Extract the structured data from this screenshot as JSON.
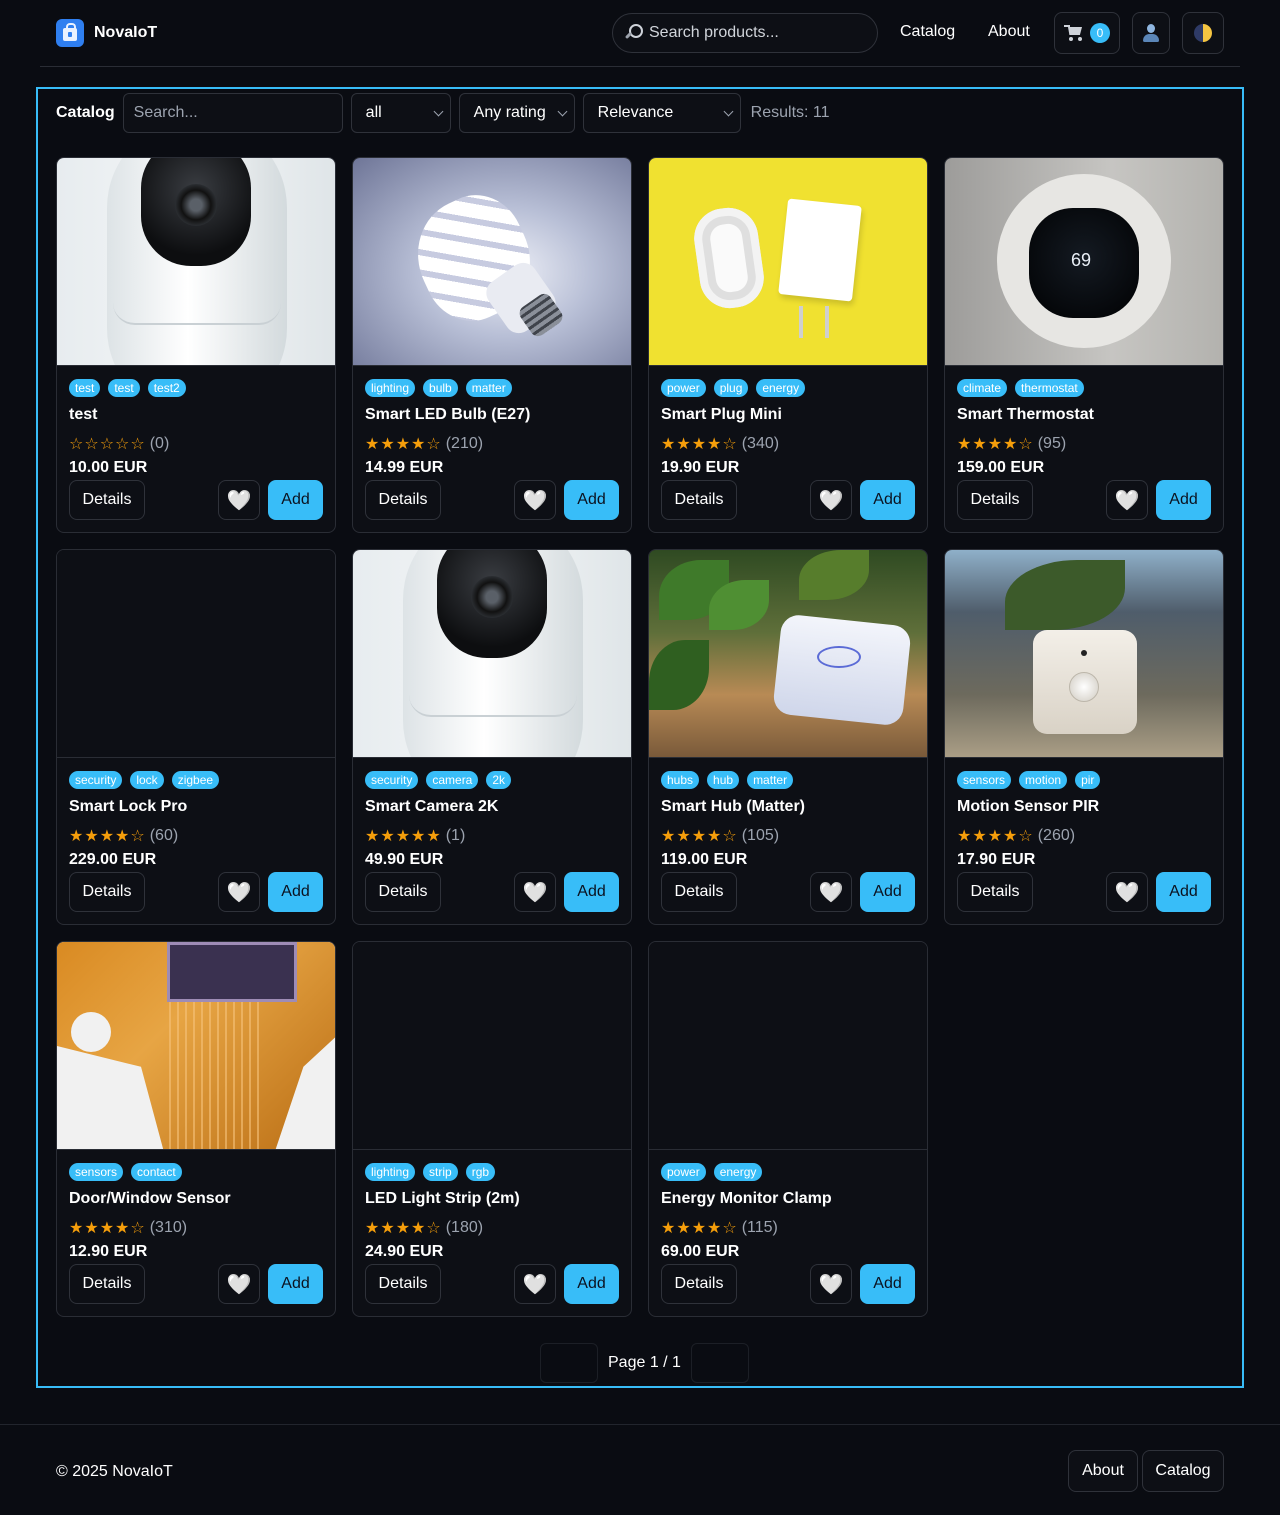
{
  "header": {
    "brand": "NovaIoT",
    "search_placeholder": "Search products...",
    "nav": {
      "catalog": "Catalog",
      "about": "About"
    },
    "cart_count": "0"
  },
  "catalog": {
    "title": "Catalog",
    "search_placeholder": "Search...",
    "category_value": "all",
    "rating_value": "Any rating",
    "sort_value": "Relevance",
    "results": "Results: 11"
  },
  "products": [
    {
      "name": "test",
      "tags": [
        "test",
        "test",
        "test2"
      ],
      "stars": "☆☆☆☆☆",
      "rating_count": "(0)",
      "price": "10.00 EUR",
      "image": "camera"
    },
    {
      "name": "Smart LED Bulb (E27)",
      "tags": [
        "lighting",
        "bulb",
        "matter"
      ],
      "stars": "★★★★☆",
      "rating_count": "(210)",
      "price": "14.99 EUR",
      "image": "bulb"
    },
    {
      "name": "Smart Plug Mini",
      "tags": [
        "power",
        "plug",
        "energy"
      ],
      "stars": "★★★★☆",
      "rating_count": "(340)",
      "price": "19.90 EUR",
      "image": "charger"
    },
    {
      "name": "Smart Thermostat",
      "tags": [
        "climate",
        "thermostat"
      ],
      "stars": "★★★★☆",
      "rating_count": "(95)",
      "price": "159.00 EUR",
      "image": "thermostat",
      "thermostat_reading": "69"
    },
    {
      "name": "Smart Lock Pro",
      "tags": [
        "security",
        "lock",
        "zigbee"
      ],
      "stars": "★★★★☆",
      "rating_count": "(60)",
      "price": "229.00 EUR",
      "image": "none"
    },
    {
      "name": "Smart Camera 2K",
      "tags": [
        "security",
        "camera",
        "2k"
      ],
      "stars": "★★★★★",
      "rating_count": "(1)",
      "price": "49.90 EUR",
      "image": "camera"
    },
    {
      "name": "Smart Hub (Matter)",
      "tags": [
        "hubs",
        "hub",
        "matter"
      ],
      "stars": "★★★★☆",
      "rating_count": "(105)",
      "price": "119.00 EUR",
      "image": "hub"
    },
    {
      "name": "Motion Sensor PIR",
      "tags": [
        "sensors",
        "motion",
        "pir"
      ],
      "stars": "★★★★☆",
      "rating_count": "(260)",
      "price": "17.90 EUR",
      "image": "pir"
    },
    {
      "name": "Door/Window Sensor",
      "tags": [
        "sensors",
        "contact"
      ],
      "stars": "★★★★☆",
      "rating_count": "(310)",
      "price": "12.90 EUR",
      "image": "pcb"
    },
    {
      "name": "LED Light Strip (2m)",
      "tags": [
        "lighting",
        "strip",
        "rgb"
      ],
      "stars": "★★★★☆",
      "rating_count": "(180)",
      "price": "24.90 EUR",
      "image": "none"
    },
    {
      "name": "Energy Monitor Clamp",
      "tags": [
        "power",
        "energy"
      ],
      "stars": "★★★★☆",
      "rating_count": "(115)",
      "price": "69.00 EUR",
      "image": "none"
    }
  ],
  "card_buttons": {
    "details": "Details",
    "add": "Add",
    "favorite": "🤍"
  },
  "pagination": {
    "label": "Page 1 / 1"
  },
  "footer": {
    "copyright": "© 2025 NovaIoT",
    "about": "About",
    "catalog": "Catalog"
  },
  "colors": {
    "accent": "#38bdf8",
    "background": "#0a0c12",
    "star": "#f59e0b"
  }
}
